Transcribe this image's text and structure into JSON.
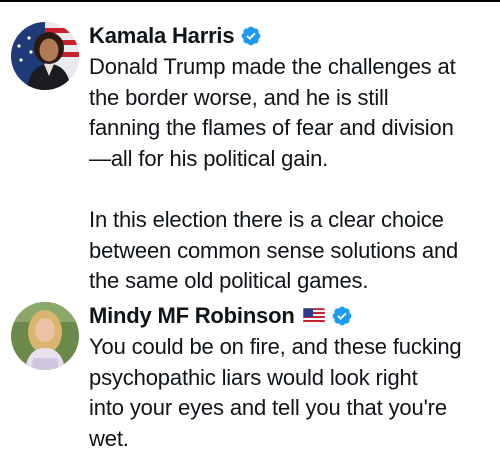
{
  "posts": [
    {
      "author": "Kamala Harris",
      "verified_icon": "verified-badge-icon",
      "avatar_icon": "kamala-harris-avatar",
      "text": "Donald Trump made the challenges at\nthe border worse, and he is still\nfanning the flames of fear and division\n—all for his political gain.\n\nIn this election there is a clear choice\nbetween common sense solutions and\nthe same old political games."
    },
    {
      "author": "Mindy MF Robinson",
      "flag_icon": "us-flag-emoji",
      "verified_icon": "verified-badge-icon",
      "avatar_icon": "mindy-robinson-avatar",
      "text": "You could be on fire, and these fucking\npsychopathic liars would look right\ninto your eyes and tell you that you're\nwet."
    }
  ],
  "colors": {
    "text": "#0f1419",
    "verified_badge": "#1d9bf0",
    "top_rule": "#000000"
  }
}
